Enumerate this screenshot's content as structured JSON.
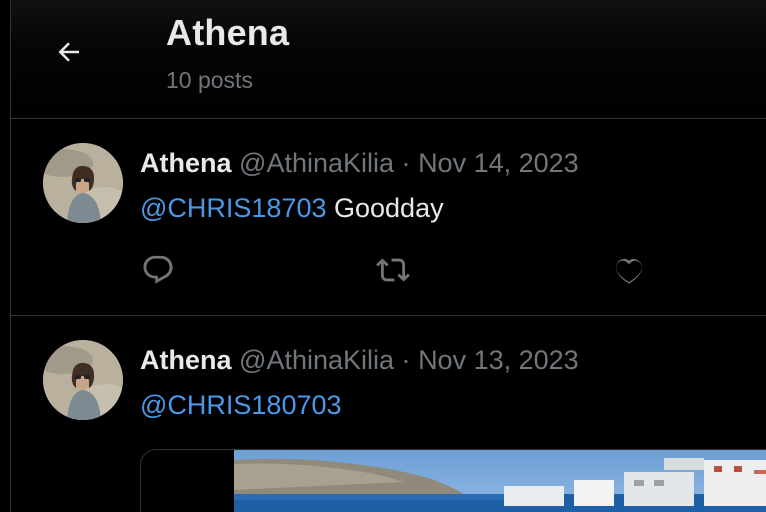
{
  "header": {
    "title": "Athena",
    "subtitle": "10 posts",
    "back_icon": "arrow-left-icon"
  },
  "posts": [
    {
      "name": "Athena",
      "handle": "@AthinaKilia",
      "dot": "·",
      "date": "Nov 14, 2023",
      "mention": "@CHRIS18703",
      "text": " Goodday",
      "actions": [
        "reply-icon",
        "retweet-icon",
        "like-icon"
      ]
    },
    {
      "name": "Athena",
      "handle": "@AthinaKilia",
      "dot": "·",
      "date": "Nov 13, 2023",
      "mention": "@CHRIS180703",
      "text": ""
    }
  ],
  "colors": {
    "background": "#000000",
    "text_primary": "#e7e9ea",
    "text_secondary": "#71767b",
    "mention": "#4a99e9",
    "border": "#2f3336"
  }
}
